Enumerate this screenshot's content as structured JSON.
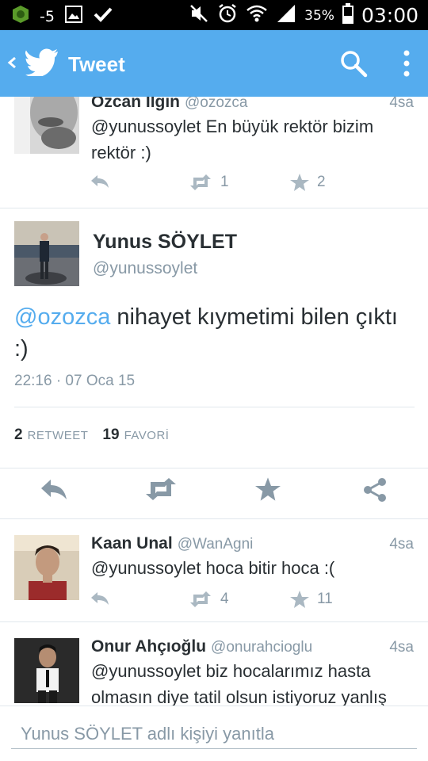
{
  "status_bar": {
    "notification_count": "-5",
    "battery": "35%",
    "time": "03:00"
  },
  "app_bar": {
    "title": "Tweet",
    "color": "#55acee"
  },
  "tweets_above": [
    {
      "name": "Özcan Ilgın",
      "handle": "@ozozca",
      "time": "4sa",
      "text": "@yunussoylet En büyük rektör bizim rektör :)",
      "retweets": "1",
      "favorites": "2"
    }
  ],
  "main_tweet": {
    "name": "Yunus SÖYLET",
    "handle": "@yunussoylet",
    "mention": "@ozozca",
    "text": " nihayet kıymetimi bilen çıktı :)",
    "date": "22:16 · 07 Oca 15",
    "retweet_count": "2",
    "retweet_label": "RETWEET",
    "favorite_count": "19",
    "favorite_label": "FAVORİ"
  },
  "replies": [
    {
      "name": "Kaan Unal",
      "handle": "@WanAgni",
      "time": "4sa",
      "text": "@yunussoylet hoca bitir hoca :(",
      "retweets": "4",
      "favorites": "11"
    },
    {
      "name": "Onur Ahçıoğlu",
      "handle": "@onurahcioglu",
      "time": "4sa",
      "text": "@yunussoylet biz hocalarımız hasta olmasın diye tatil olsun istiyoruz yanlış"
    }
  ],
  "reply_bar": {
    "placeholder": "Yunus SÖYLET adlı kişiyi yanıtla"
  },
  "colors": {
    "accent": "#55acee",
    "muted": "#8899a6",
    "text": "#292f33"
  }
}
